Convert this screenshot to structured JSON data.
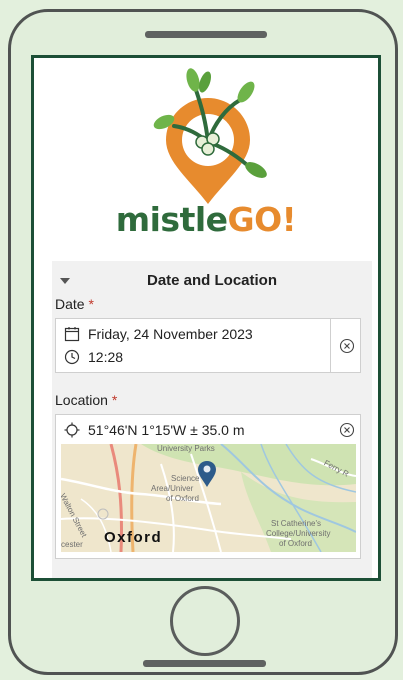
{
  "app": {
    "brand_part1": "mistle",
    "brand_part2": "GO!"
  },
  "section": {
    "title": "Date and Location"
  },
  "date": {
    "label": "Date",
    "required_mark": "*",
    "date_value": "Friday, 24 November 2023",
    "time_value": "12:28"
  },
  "location": {
    "label": "Location",
    "required_mark": "*",
    "value": "51°46'N 1°15'W ± 35.0 m"
  },
  "map": {
    "labels": {
      "parks": "University Parks",
      "science_1": "Science",
      "science_2": "Area/Univer",
      "science_3": "of Oxford",
      "walton": "Walton Street",
      "ferry": "Ferry R",
      "catherine_1": "St Catherine's",
      "catherine_2": "College/University",
      "catherine_3": "of Oxford",
      "cester": "cester",
      "city": "Oxford"
    }
  },
  "colors": {
    "brand_green": "#2f6b3c",
    "brand_orange": "#e78b2e",
    "frame_border": "#1c4f36",
    "required": "#c0392b",
    "pin": "#2d5b8a"
  },
  "icons": [
    "calendar-icon",
    "clock-icon",
    "clear-icon",
    "location-crosshair-icon",
    "map-pin-icon",
    "mistletoe-logo-icon",
    "chevron-down-icon"
  ]
}
